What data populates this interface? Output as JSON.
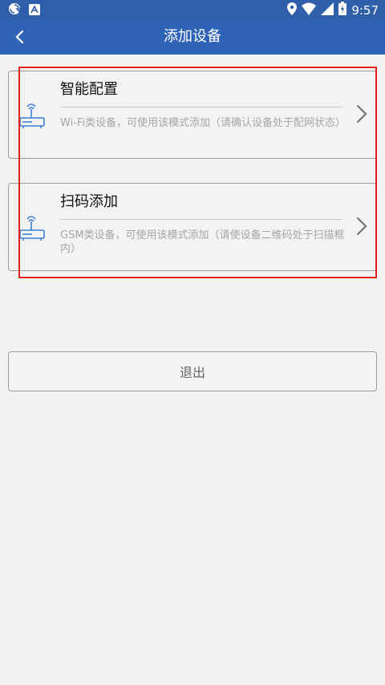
{
  "status_bar": {
    "time": "9:57",
    "icons": [
      "sync-icon",
      "notification-a-icon",
      "location-icon",
      "wifi-icon",
      "signal-icon",
      "battery-icon"
    ]
  },
  "app_bar": {
    "title": "添加设备",
    "back_icon": "chevron-left-icon"
  },
  "options": [
    {
      "title": "智能配置",
      "description": "Wi-Fi类设备，可使用该模式添加（请确认设备处于配网状态）",
      "icon": "router-icon"
    },
    {
      "title": "扫码添加",
      "description": "GSM类设备，可使用该模式添加（请使设备二维码处于扫描框内）",
      "icon": "router-icon"
    }
  ],
  "exit_label": "退出",
  "colors": {
    "app_bar": "#2f63b5",
    "status_bar": "#2f5fa8",
    "highlight": "#e0201f",
    "icon_blue": "#3b7fd4"
  }
}
